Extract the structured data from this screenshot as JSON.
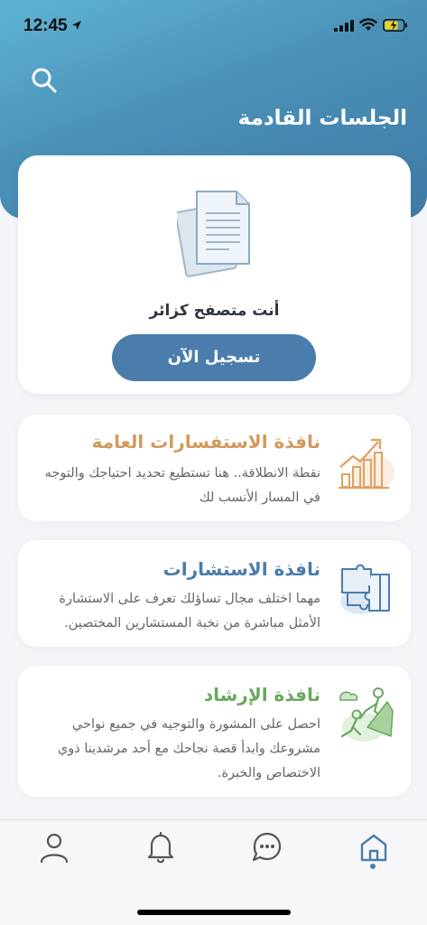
{
  "status_bar": {
    "time": "12:45"
  },
  "header": {
    "title": "الجلسات القادمة"
  },
  "guest_card": {
    "message": "أنت متصفح كزائر",
    "register_label": "تسجيل الآن"
  },
  "services": [
    {
      "title": "نافذة الاستفسارات العامة",
      "description": "نقطة الانطلاقة.. هنا تستطيع تحديد احتياجك والتوجه في المسار الأنسب لك",
      "title_color": "#d29a5e",
      "icon": "growth-chart-icon"
    },
    {
      "title": "نافذة الاستشارات",
      "description": "مهما اختلف مجال تساؤلك تعرف على الاستشارة الأمثل مباشرة من نخبة المستشارين المختصين.",
      "title_color": "#4a7dab",
      "icon": "puzzle-icon"
    },
    {
      "title": "نافذة الإرشاد",
      "description": "احصل على المشورة والتوجيه في جميع نواحي مشروعك وابدأ قصة نجاحك مع أحد مرشدينا ذوي الاختصاص والخبرة.",
      "title_color": "#6aa860",
      "icon": "mentor-climb-icon"
    }
  ],
  "tabbar": {
    "items": [
      "profile-icon",
      "bell-icon",
      "chat-icon",
      "home-icon"
    ],
    "active": "home-icon"
  },
  "colors": {
    "primary": "#4a7dab",
    "header_gradient_start": "#5fb3d2",
    "header_gradient_end": "#3f7aa6",
    "orange": "#d29a5e",
    "green": "#6aa860"
  }
}
